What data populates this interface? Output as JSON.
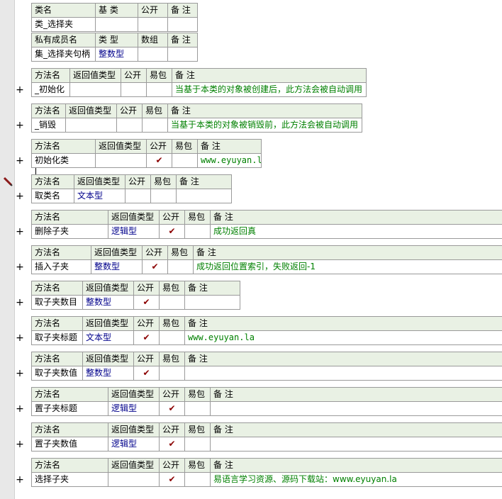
{
  "class_table": {
    "headers": [
      "类名",
      "基 类",
      "公开",
      "备 注"
    ],
    "row": [
      "类_选择夹",
      "",
      "",
      ""
    ]
  },
  "member_table": {
    "headers": [
      "私有成员名",
      "类 型",
      "数组",
      "备 注"
    ],
    "row": [
      "集_选择夹句柄",
      "整数型",
      "",
      ""
    ]
  },
  "method_headers": [
    "方法名",
    "返回值类型",
    "公开",
    "易包",
    "备 注"
  ],
  "check_mark": "✔",
  "expand_symbol": "+",
  "methods": [
    {
      "name": "_初始化",
      "ret": "",
      "public": false,
      "note": "当基于本类的对象被创建后，此方法会被自动调用"
    },
    {
      "name": "_销毁",
      "ret": "",
      "public": false,
      "note": "当基于本类的对象被销毁前，此方法会被自动调用"
    },
    {
      "name": "初始化类",
      "ret": "",
      "public": true,
      "note": "www.eyuyan.la"
    },
    {
      "name": "取类名",
      "ret": "文本型",
      "public": false,
      "note": ""
    },
    {
      "name": "删除子夹",
      "ret": "逻辑型",
      "public": true,
      "note": "成功返回真"
    },
    {
      "name": "插入子夹",
      "ret": "整数型",
      "public": true,
      "note": "成功返回位置索引，失败返回-1"
    },
    {
      "name": "取子夹数目",
      "ret": "整数型",
      "public": true,
      "note": ""
    },
    {
      "name": "取子夹标题",
      "ret": "文本型",
      "public": true,
      "note": "www.eyuyan.la"
    },
    {
      "name": "取子夹数值",
      "ret": "整数型",
      "public": true,
      "note": ""
    },
    {
      "name": "置子夹标题",
      "ret": "逻辑型",
      "public": true,
      "note": ""
    },
    {
      "name": "置子夹数值",
      "ret": "逻辑型",
      "public": true,
      "note": ""
    },
    {
      "name": "选择子夹",
      "ret": "",
      "public": true,
      "note": "易语言学习资源、源码下载站：www.eyuyan.la"
    }
  ],
  "colors": {
    "header_bg": "#e9f1e4",
    "type_text": "#00008b",
    "note_text": "#008000",
    "check": "#8b0000"
  }
}
